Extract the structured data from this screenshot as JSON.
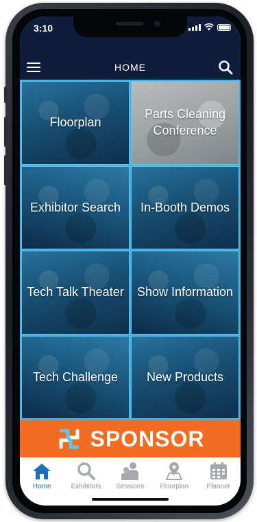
{
  "status": {
    "time": "3:10"
  },
  "header": {
    "title": "HOME"
  },
  "tiles": [
    {
      "label": "Floorplan"
    },
    {
      "label": "Parts Cleaning Conference"
    },
    {
      "label": "Exhibitor Search"
    },
    {
      "label": "In-Booth Demos"
    },
    {
      "label": "Tech Talk Theater"
    },
    {
      "label": "Show Information"
    },
    {
      "label": "Tech Challenge"
    },
    {
      "label": "New Products"
    }
  ],
  "sponsor": {
    "label": "SPONSOR"
  },
  "tabbar": [
    {
      "label": "Home",
      "icon": "home-icon",
      "active": true
    },
    {
      "label": "Exhibitors",
      "icon": "magnifier-icon",
      "active": false
    },
    {
      "label": "Sessions",
      "icon": "people-icon",
      "active": false
    },
    {
      "label": "Floorplan",
      "icon": "map-pin-icon",
      "active": false
    },
    {
      "label": "Planner",
      "icon": "calendar-icon",
      "active": false
    }
  ],
  "colors": {
    "header_bg": "#0f1d3a",
    "tile_border": "#48b2e6",
    "sponsor_bg": "#f26b21",
    "tab_active": "#1d6fb8",
    "tab_inactive": "#8e9297"
  }
}
